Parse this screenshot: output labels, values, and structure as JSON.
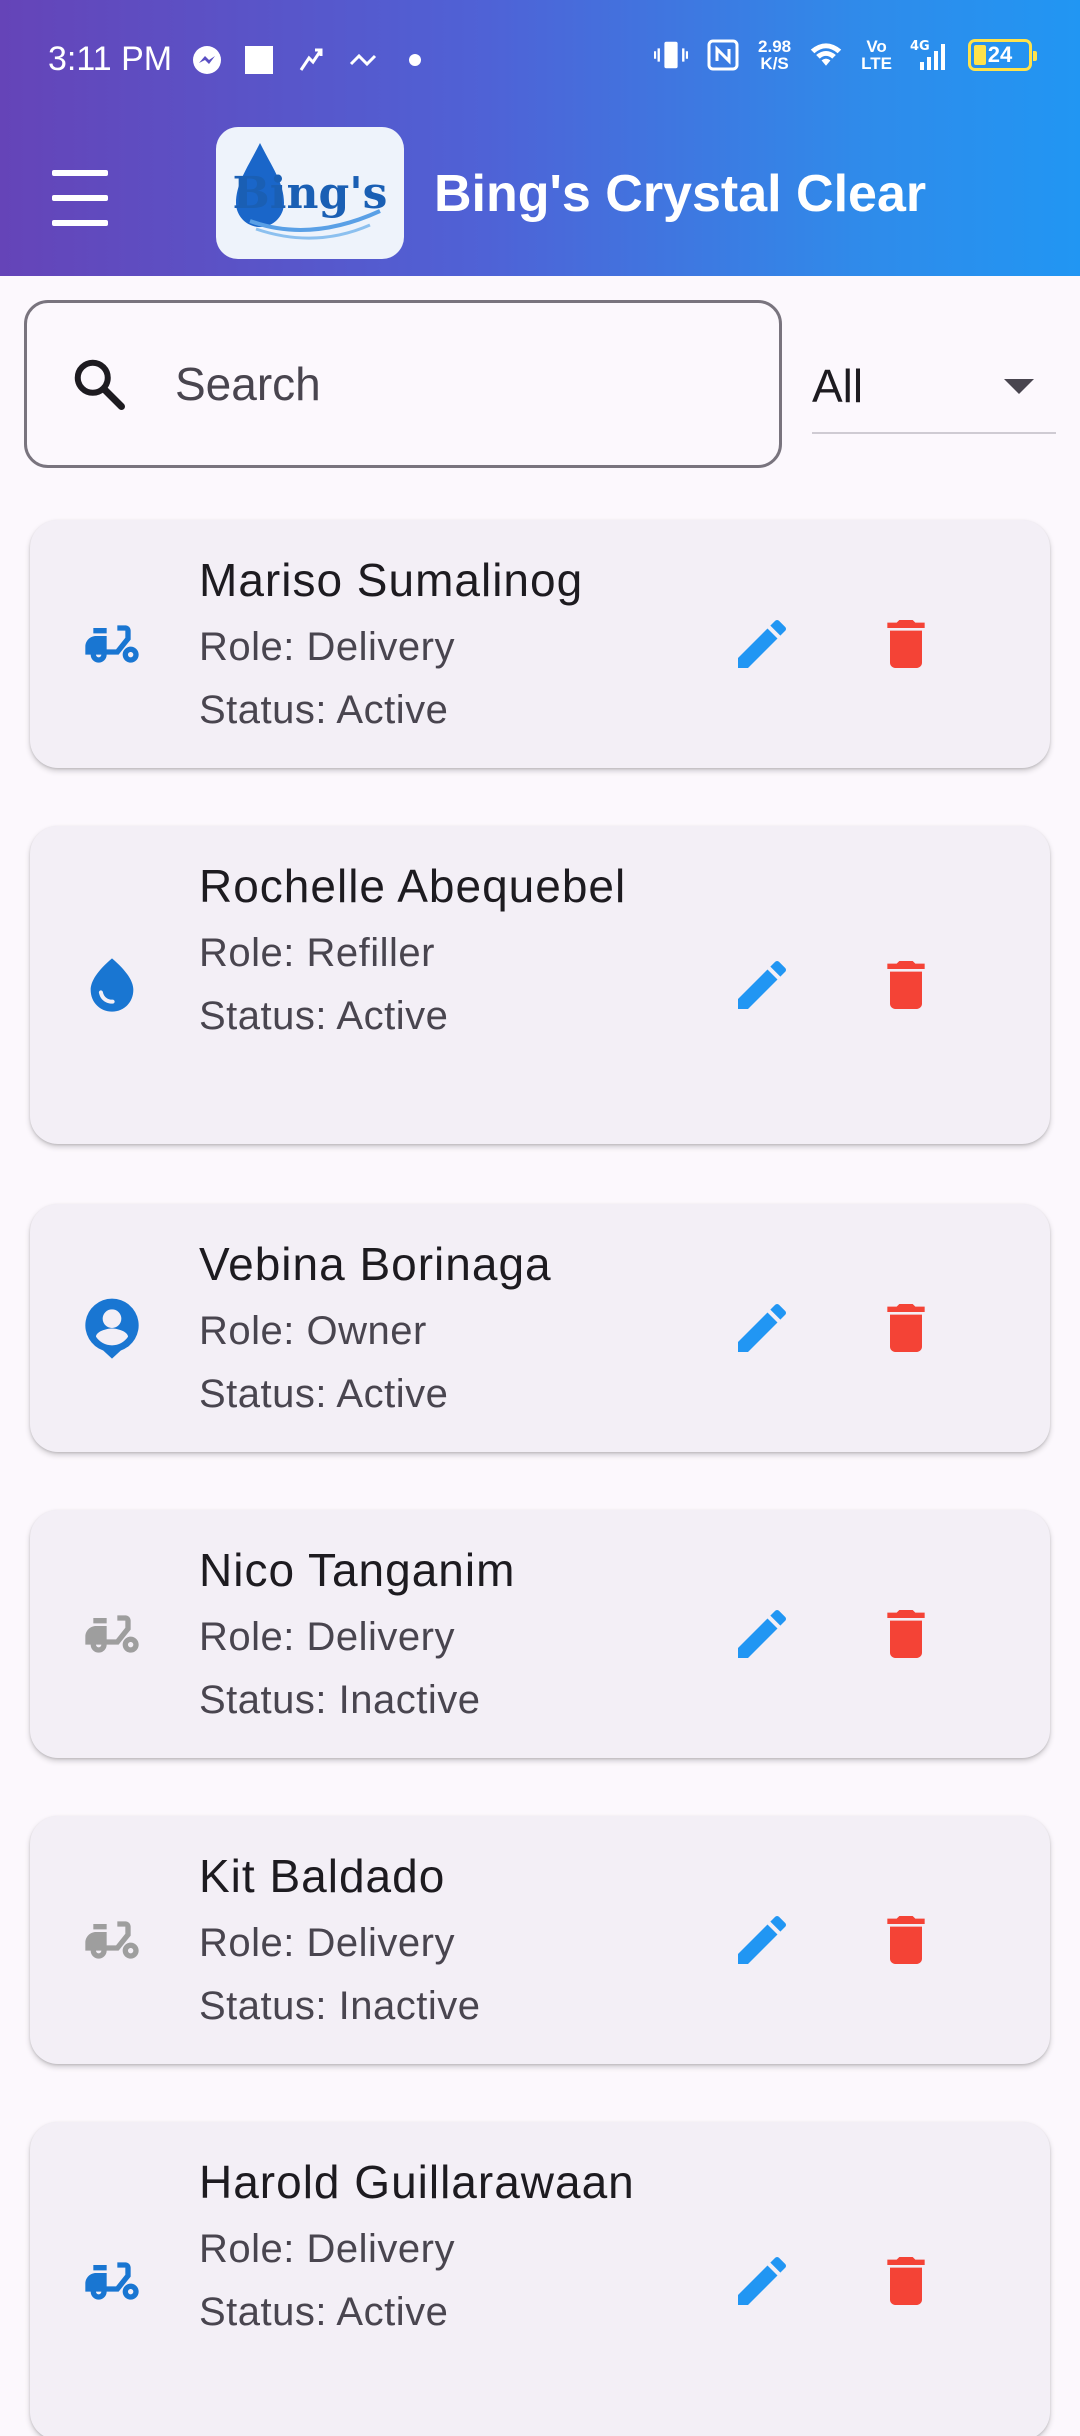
{
  "status_bar": {
    "time": "3:11 PM",
    "net_speed_value": "2.98",
    "net_speed_unit": "K/S",
    "volte_top": "Vo",
    "volte_bottom": "LTE",
    "network": "4G",
    "battery": "24"
  },
  "app_bar": {
    "logo_text": "Bing's",
    "title": "Bing's Crystal Clear"
  },
  "search": {
    "placeholder": "Search"
  },
  "filter": {
    "selected": "All"
  },
  "colors": {
    "accent": "#2196f3",
    "delete": "#f44336",
    "inactive": "#9e9e9e",
    "role_icon_active": "#1976d2"
  },
  "employees": [
    {
      "name": "Mariso Sumalinog",
      "role": "Role: Delivery",
      "status": "Status: Active",
      "icon": "delivery-scooter-icon",
      "active": true
    },
    {
      "name": "Rochelle Abequebel",
      "role": "Role: Refiller",
      "status": "Status: Active",
      "icon": "water-drop-icon",
      "active": true
    },
    {
      "name": "Vebina Borinaga",
      "role": "Role: Owner",
      "status": "Status: Active",
      "icon": "person-pin-icon",
      "active": true
    },
    {
      "name": "Nico Tanganim",
      "role": "Role: Delivery",
      "status": "Status: Inactive",
      "icon": "delivery-scooter-icon",
      "active": false
    },
    {
      "name": "Kit Baldado",
      "role": "Role: Delivery",
      "status": "Status: Inactive",
      "icon": "delivery-scooter-icon",
      "active": false
    },
    {
      "name": "Harold Guillarawaan",
      "role": "Role: Delivery",
      "status": "Status: Active",
      "icon": "delivery-scooter-icon",
      "active": true
    }
  ]
}
